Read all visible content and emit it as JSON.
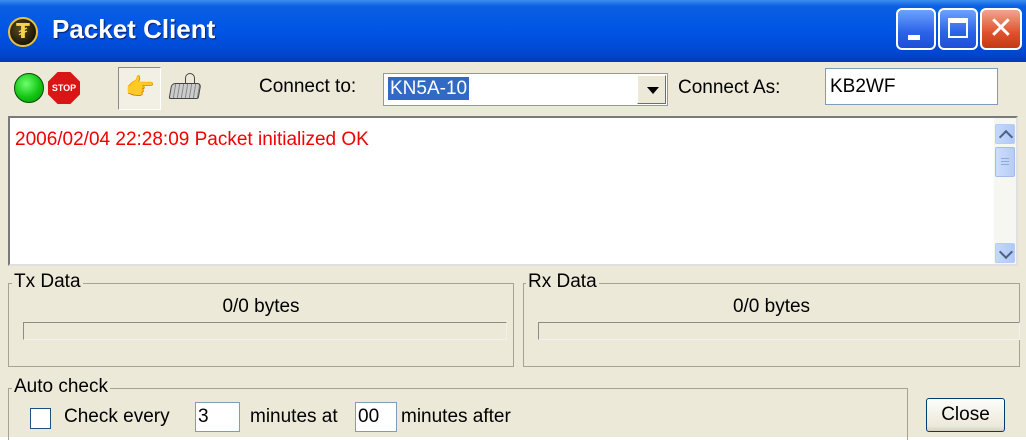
{
  "window": {
    "title": "Packet Client",
    "icon": "currency-coin-icon",
    "controls": [
      "minimize-icon",
      "maximize-icon",
      "close-icon"
    ]
  },
  "toolbar": {
    "connect_icon": "green-go-icon",
    "stop_icon": "stop-sign-icon",
    "stop_text": "STOP",
    "mode_icon": "hand-pointer-icon",
    "keyboard_icon": "keyboard-icon",
    "connect_to_label": "Connect to:",
    "connect_to_value": "KN5A-10",
    "connect_as_label": "Connect As:",
    "connect_as_value": "KB2WF"
  },
  "log": {
    "lines": [
      "2006/02/04 22:28:09 Packet initialized OK"
    ],
    "text_color": "#f20000"
  },
  "tx": {
    "title": "Tx Data",
    "bytes": "0/0 bytes",
    "progress": 0
  },
  "rx": {
    "title": "Rx Data",
    "bytes": "0/0 bytes",
    "progress": 0
  },
  "auto_check": {
    "title": "Auto check",
    "checked": false,
    "check_every_label": "Check every",
    "every_value": "3",
    "minutes_at_label": "minutes at",
    "at_value": "00",
    "minutes_after_label": "minutes after"
  },
  "buttons": {
    "close_label": "Close"
  },
  "colors": {
    "titlebar": "#0055e5",
    "face": "#ece9d8",
    "selection": "#316ac5"
  }
}
